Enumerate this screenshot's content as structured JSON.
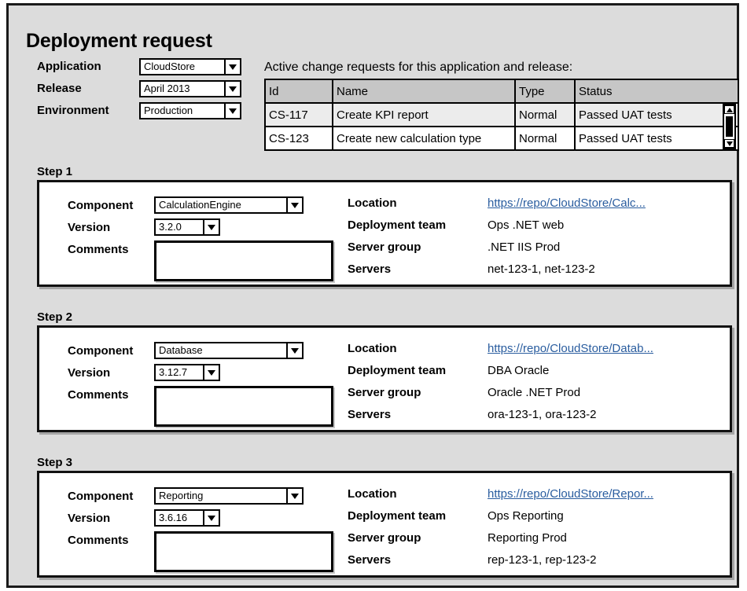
{
  "window": {
    "title": "Deployment request"
  },
  "form": {
    "fields": [
      {
        "label": "Application",
        "value": "CloudStore",
        "icon": "chevron-down-icon"
      },
      {
        "label": "Release",
        "value": "April 2013",
        "icon": "chevron-down-icon"
      },
      {
        "label": "Environment",
        "value": "Production",
        "icon": "chevron-down-icon"
      }
    ]
  },
  "change_requests": {
    "caption": "Active change requests for this application and release:",
    "columns": [
      "Id",
      "Name",
      "Type",
      "Status"
    ],
    "rows": [
      {
        "id": "CS-117",
        "name": "Create KPI report",
        "type": "Normal",
        "status": "Passed UAT tests"
      },
      {
        "id": "CS-123",
        "name": "Create new calculation type",
        "type": "Normal",
        "status": "Passed UAT tests"
      }
    ],
    "scrollbar": {
      "up_icon": "scroll-up-arrow-icon",
      "down_icon": "scroll-down-arrow-icon",
      "thumb": "scrollbar-thumb"
    }
  },
  "steps": [
    {
      "label": "Step 1",
      "left": {
        "component_label": "Component",
        "component_value": "CalculationEngine",
        "version_label": "Version",
        "version_value": "3.2.0",
        "comments_label": "Comments",
        "comments_value": ""
      },
      "right": {
        "location_label": "Location",
        "location_value": "https://repo/CloudStore/Calc...",
        "team_label": "Deployment team",
        "team_value": "Ops .NET web",
        "group_label": "Server group",
        "group_value": ".NET IIS Prod",
        "servers_label": "Servers",
        "servers_value": "net-123-1, net-123-2"
      }
    },
    {
      "label": "Step 2",
      "left": {
        "component_label": "Component",
        "component_value": "Database",
        "version_label": "Version",
        "version_value": "3.12.7",
        "comments_label": "Comments",
        "comments_value": ""
      },
      "right": {
        "location_label": "Location",
        "location_value": "https://repo/CloudStore/Datab...",
        "team_label": "Deployment team",
        "team_value": "DBA Oracle",
        "group_label": "Server group",
        "group_value": "Oracle .NET Prod",
        "servers_label": "Servers",
        "servers_value": "ora-123-1, ora-123-2"
      }
    },
    {
      "label": "Step 3",
      "left": {
        "component_label": "Component",
        "component_value": "Reporting",
        "version_label": "Version",
        "version_value": "3.6.16",
        "comments_label": "Comments",
        "comments_value": ""
      },
      "right": {
        "location_label": "Location",
        "location_value": "https://repo/CloudStore/Repor...",
        "team_label": "Deployment team",
        "team_value": "Ops Reporting",
        "group_label": "Server group",
        "group_value": "Reporting Prod",
        "servers_label": "Servers",
        "servers_value": "rep-123-1, rep-123-2"
      }
    }
  ],
  "colors": {
    "window_background": "#dcdcdc",
    "panel_background": "#ffffff",
    "border": "#111111",
    "table_header": "#c6c6c6",
    "table_alt_row": "#ececec",
    "link": "#2a5d9f"
  }
}
